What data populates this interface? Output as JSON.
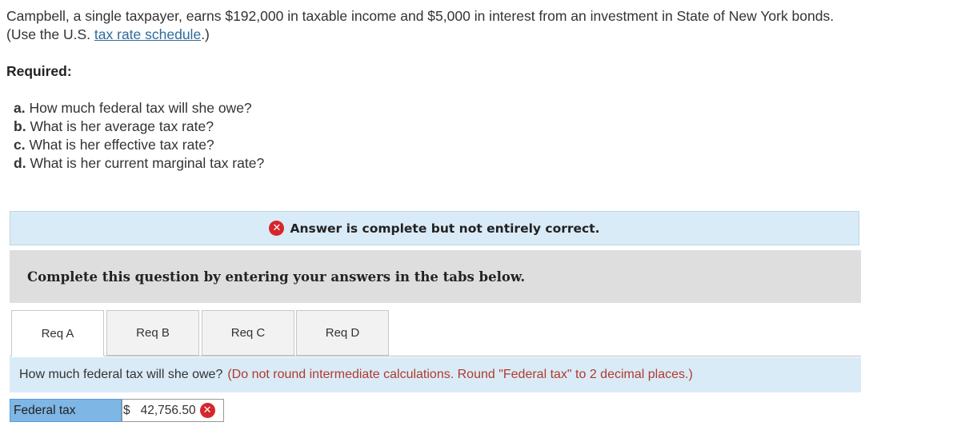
{
  "intro": {
    "line1": "Campbell, a single taxpayer, earns $192,000 in taxable income and $5,000 in interest from an investment in State of New York bonds.",
    "line2_prefix": "(Use the U.S. ",
    "link_text": "tax rate schedule",
    "line2_suffix": ".)"
  },
  "required_label": "Required:",
  "questions": [
    {
      "letter": "a.",
      "text": "How much federal tax will she owe?"
    },
    {
      "letter": "b.",
      "text": "What is her average tax rate?"
    },
    {
      "letter": "c.",
      "text": "What is her effective tax rate?"
    },
    {
      "letter": "d.",
      "text": "What is her current marginal tax rate?"
    }
  ],
  "status": {
    "icon": "x-circle-icon",
    "text": "Answer is complete but not entirely correct.",
    "color": "#d6262c"
  },
  "instruction": "Complete this question by entering your answers in the tabs below.",
  "tabs": [
    {
      "label": "Req A",
      "active": true
    },
    {
      "label": "Req B",
      "active": false
    },
    {
      "label": "Req C",
      "active": false
    },
    {
      "label": "Req D",
      "active": false
    }
  ],
  "question_bar": {
    "text": "How much federal tax will she owe?",
    "hint": "(Do not round intermediate calculations. Round \"Federal tax\" to 2 decimal places.)"
  },
  "answer": {
    "label": "Federal tax",
    "currency": "$",
    "value": "42,756.50",
    "status_icon": "x-circle-icon"
  }
}
